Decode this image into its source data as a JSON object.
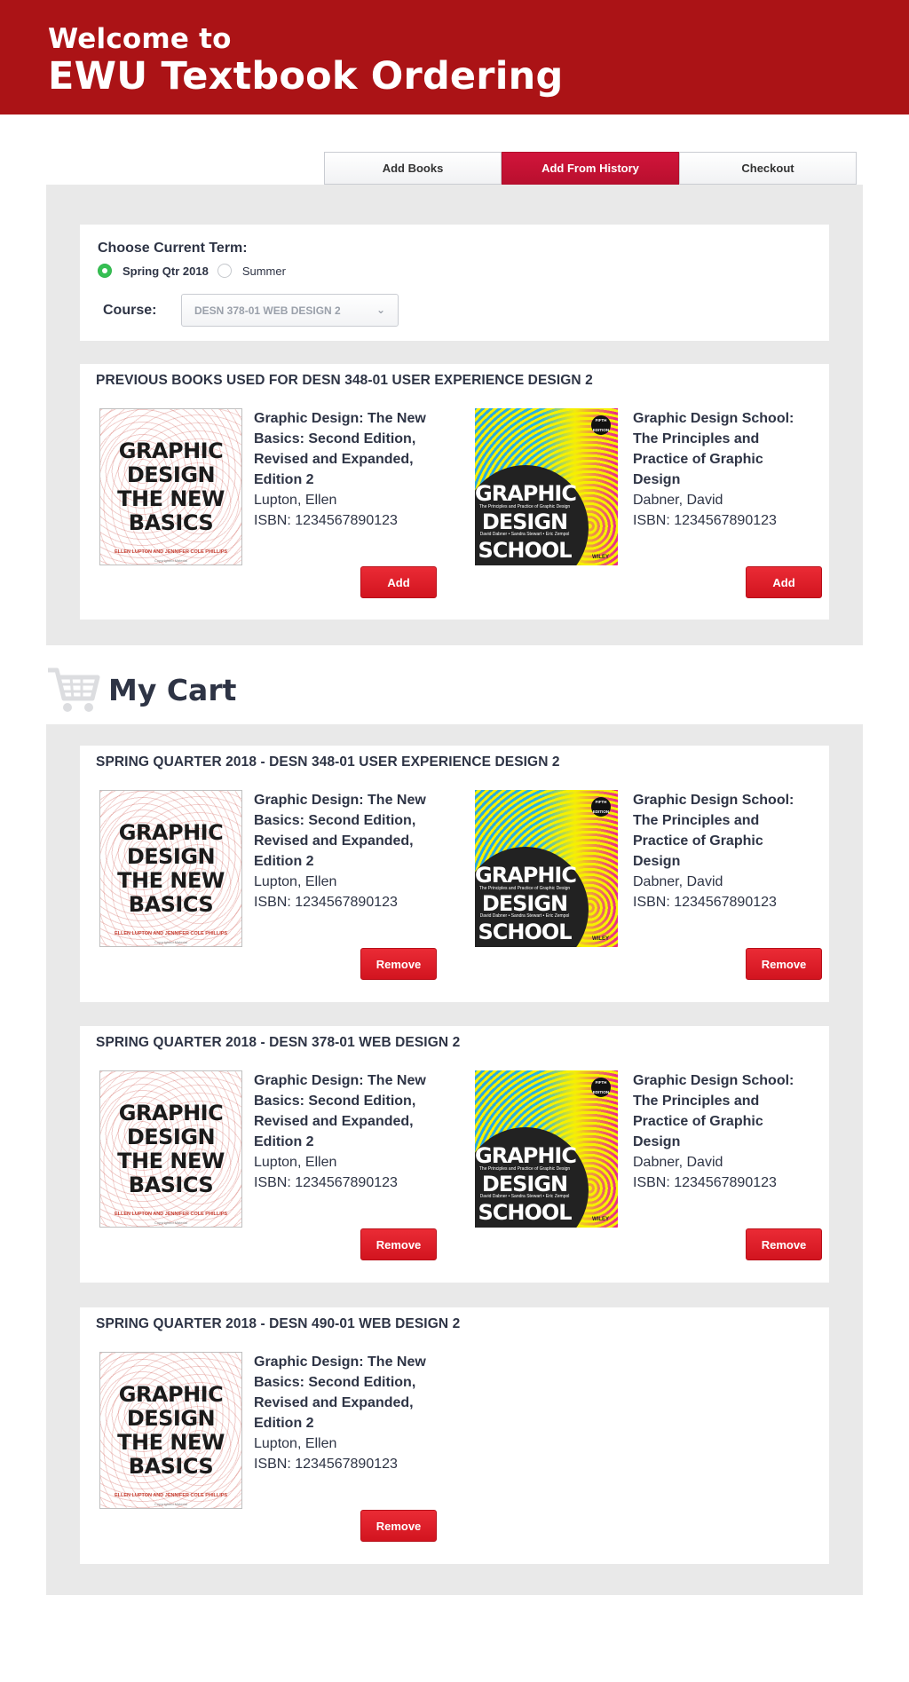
{
  "header": {
    "line1": "Welcome to",
    "line2": "EWU Textbook Ordering"
  },
  "tabs": [
    {
      "label": "Add Books",
      "active": false
    },
    {
      "label": "Add From History",
      "active": true
    },
    {
      "label": "Checkout",
      "active": false
    }
  ],
  "term": {
    "label": "Choose Current Term:",
    "options": [
      {
        "label": "Spring Qtr 2018",
        "selected": true
      },
      {
        "label": "Summer",
        "selected": false
      }
    ],
    "course_label": "Course:",
    "course_value": "DESN 378-01 WEB DESIGN 2"
  },
  "history": {
    "title": "PREVIOUS BOOKS USED FOR DESN 348-01 USER EXPERIENCE DESIGN 2",
    "books": [
      {
        "title": "Graphic Design: The New Basics: Second Edition, Revised and Expanded, Edition 2",
        "author": "Lupton, Ellen",
        "isbn": "ISBN: 1234567890123",
        "action": "Add"
      },
      {
        "title": "Graphic Design School: The Principles and Practice of Graphic Design",
        "author": "Dabner, David",
        "isbn": "ISBN: 1234567890123",
        "action": "Add"
      }
    ]
  },
  "cart": {
    "title": "My Cart",
    "sections": [
      {
        "title": "SPRING QUARTER 2018 - DESN 348-01 USER EXPERIENCE DESIGN 2",
        "books": [
          {
            "title": "Graphic Design: The New Basics: Second Edition, Revised and Expanded, Edition 2",
            "author": "Lupton, Ellen",
            "isbn": "ISBN: 1234567890123",
            "action": "Remove"
          },
          {
            "title": "Graphic Design School: The Principles and Practice of Graphic Design",
            "author": "Dabner, David",
            "isbn": "ISBN: 1234567890123",
            "action": "Remove"
          }
        ]
      },
      {
        "title": "SPRING QUARTER 2018 - DESN 378-01 WEB DESIGN 2",
        "books": [
          {
            "title": "Graphic Design: The New Basics: Second Edition, Revised and Expanded, Edition 2",
            "author": "Lupton, Ellen",
            "isbn": "ISBN: 1234567890123",
            "action": "Remove"
          },
          {
            "title": "Graphic Design School: The Principles and Practice of Graphic Design",
            "author": "Dabner, David",
            "isbn": "ISBN: 1234567890123",
            "action": "Remove"
          }
        ]
      },
      {
        "title": "SPRING QUARTER 2018 - DESN 490-01 WEB DESIGN 2",
        "books": [
          {
            "title": "Graphic Design: The New Basics: Second Edition, Revised and Expanded, Edition 2",
            "author": "Lupton, Ellen",
            "isbn": "ISBN: 1234567890123",
            "action": "Remove"
          }
        ]
      }
    ]
  },
  "covers": {
    "gd": {
      "lines": [
        "GRAPHIC",
        "DESIGN",
        "THE NEW",
        "BASICS"
      ],
      "authors": "ELLEN LUPTON AND JENNIFER COLE PHILLIPS",
      "mark": "Copyrighted Material"
    },
    "gds": {
      "lines": [
        "GRAPHIC",
        "DESIGN",
        "SCHOOL"
      ],
      "subtitle": "The Principles and Practice of Graphic Design",
      "authors": "David Dabner • Sandra Stewart • Eric Zempol",
      "edition": "FIFTH EDITION",
      "publisher": "WILEY"
    }
  },
  "colors": {
    "header_bg": "#ab1316",
    "accent": "#d2141f",
    "panel_bg": "#e9e9e9",
    "text": "#2e3445"
  }
}
